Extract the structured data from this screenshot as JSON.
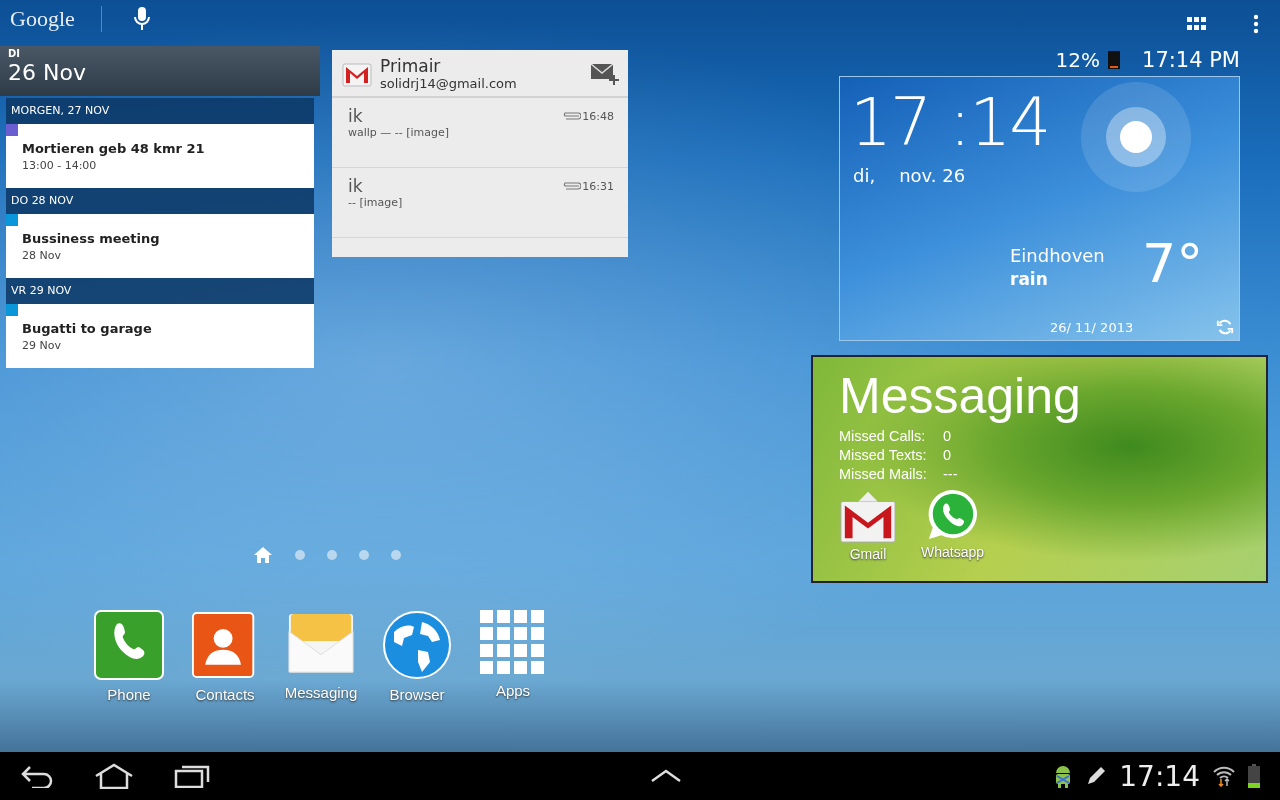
{
  "search_bar": {
    "logo": "Google"
  },
  "calendar": {
    "weekday": "DI",
    "date": "26 Nov",
    "days": [
      {
        "header": "MORGEN, 27 NOV",
        "events": [
          {
            "title": "Mortieren geb 48 kmr 21",
            "time": "13:00 - 14:00",
            "color": "#6a5fd0"
          }
        ]
      },
      {
        "header": "DO 28 NOV",
        "events": [
          {
            "title": "Bussiness meeting",
            "time": "28 Nov",
            "color": "#0a96d8"
          }
        ]
      },
      {
        "header": "VR 29 NOV",
        "events": [
          {
            "title": "Bugatti to garage",
            "time": "29 Nov",
            "color": "#0a96d8"
          }
        ]
      }
    ]
  },
  "gmail": {
    "label": "Primair",
    "account": "solidrj14@gmail.com",
    "messages": [
      {
        "sender": "ik",
        "snippet": "wallp — -- [image]",
        "time": "16:48",
        "attachment": true
      },
      {
        "sender": "ik",
        "snippet": "-- [image]",
        "time": "16:31",
        "attachment": true
      }
    ]
  },
  "status": {
    "battery": "12%",
    "time": "17:14 PM"
  },
  "weather": {
    "time": "17 :14",
    "weekday": "di,",
    "date": "nov. 26",
    "city": "Eindhoven",
    "condition": "rain",
    "temperature": "7°",
    "updated": "26/ 11/ 2013"
  },
  "messaging": {
    "title": "Messaging",
    "counters": [
      {
        "label": "Missed Calls:",
        "value": "0"
      },
      {
        "label": "Missed Texts:",
        "value": "0"
      },
      {
        "label": "Missed Mails:",
        "value": "---"
      }
    ],
    "apps": [
      {
        "label": "Gmail",
        "kind": "gmail"
      },
      {
        "label": "Whatsapp",
        "kind": "whatsapp"
      }
    ]
  },
  "pages": [
    {
      "kind": "home",
      "selected": true
    },
    {
      "kind": "dot",
      "selected": false
    },
    {
      "kind": "dot",
      "selected": false
    },
    {
      "kind": "dot",
      "selected": false
    },
    {
      "kind": "dot",
      "selected": false
    }
  ],
  "dock": [
    {
      "label": "Phone",
      "kind": "phone"
    },
    {
      "label": "Contacts",
      "kind": "contacts"
    },
    {
      "label": "Messaging",
      "kind": "messaging"
    },
    {
      "label": "Browser",
      "kind": "browser"
    },
    {
      "label": "Apps",
      "kind": "apps"
    }
  ],
  "nav_bar": {
    "time": "17:14"
  }
}
